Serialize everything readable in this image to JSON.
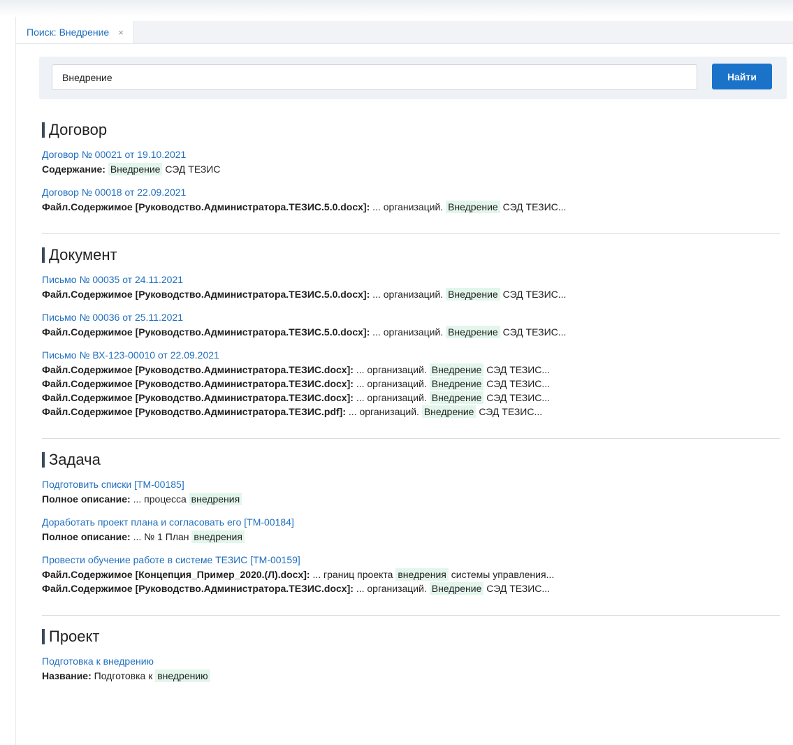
{
  "tab": {
    "label": "Поиск: Внедрение",
    "close_symbol": "×"
  },
  "search": {
    "value": "Внедрение",
    "button_label": "Найти"
  },
  "sections": [
    {
      "title": "Договор",
      "results": [
        {
          "link": "Договор № 00021 от 19.10.2021",
          "lines": [
            {
              "label": "Содержание:",
              "pre": "",
              "highlight": "Внедрение",
              "post": "СЭД ТЕЗИС"
            }
          ]
        },
        {
          "link": "Договор № 00018 от 22.09.2021",
          "lines": [
            {
              "label": "Файл.Содержимое [Руководство.Администратора.ТЕЗИС.5.0.docx]:",
              "pre": "... организаций.",
              "highlight": "Внедрение",
              "post": "СЭД ТЕЗИС..."
            }
          ]
        }
      ]
    },
    {
      "title": "Документ",
      "results": [
        {
          "link": "Письмо № 00035 от 24.11.2021",
          "lines": [
            {
              "label": "Файл.Содержимое [Руководство.Администратора.ТЕЗИС.5.0.docx]:",
              "pre": "... организаций.",
              "highlight": "Внедрение",
              "post": "СЭД ТЕЗИС..."
            }
          ]
        },
        {
          "link": "Письмо № 00036 от 25.11.2021",
          "lines": [
            {
              "label": "Файл.Содержимое [Руководство.Администратора.ТЕЗИС.5.0.docx]:",
              "pre": "... организаций.",
              "highlight": "Внедрение",
              "post": "СЭД ТЕЗИС..."
            }
          ]
        },
        {
          "link": "Письмо № ВХ-123-00010 от 22.09.2021",
          "lines": [
            {
              "label": "Файл.Содержимое [Руководство.Администратора.ТЕЗИС.docx]:",
              "pre": "... организаций.",
              "highlight": "Внедрение",
              "post": "СЭД ТЕЗИС..."
            },
            {
              "label": "Файл.Содержимое [Руководство.Администратора.ТЕЗИС.docx]:",
              "pre": "... организаций.",
              "highlight": "Внедрение",
              "post": "СЭД ТЕЗИС..."
            },
            {
              "label": "Файл.Содержимое [Руководство.Администратора.ТЕЗИС.docx]:",
              "pre": "... организаций.",
              "highlight": "Внедрение",
              "post": "СЭД ТЕЗИС..."
            },
            {
              "label": "Файл.Содержимое [Руководство.Администратора.ТЕЗИС.pdf]:",
              "pre": "... организаций.",
              "highlight": "Внедрение",
              "post": "СЭД ТЕЗИС..."
            }
          ]
        }
      ]
    },
    {
      "title": "Задача",
      "results": [
        {
          "link": "Подготовить списки [ТМ-00185]",
          "lines": [
            {
              "label": "Полное описание:",
              "pre": "... процесса",
              "highlight": "внедрения",
              "post": ""
            }
          ]
        },
        {
          "link": "Доработать проект плана и согласовать его [ТМ-00184]",
          "lines": [
            {
              "label": "Полное описание:",
              "pre": "... № 1 План",
              "highlight": "внедрения",
              "post": ""
            }
          ]
        },
        {
          "link": "Провести обучение работе в системе ТЕЗИС [ТМ-00159]",
          "lines": [
            {
              "label": "Файл.Содержимое [Концепция_Пример_2020.(Л).docx]:",
              "pre": "... границ проекта",
              "highlight": "внедрения",
              "post": "системы управления..."
            },
            {
              "label": "Файл.Содержимое [Руководство.Администратора.ТЕЗИС.docx]:",
              "pre": "... организаций.",
              "highlight": "Внедрение",
              "post": "СЭД ТЕЗИС..."
            }
          ]
        }
      ]
    },
    {
      "title": "Проект",
      "results": [
        {
          "link": "Подготовка к внедрению",
          "lines": [
            {
              "label": "Название:",
              "pre": "Подготовка к",
              "highlight": "внедрению",
              "post": ""
            }
          ]
        }
      ]
    }
  ]
}
